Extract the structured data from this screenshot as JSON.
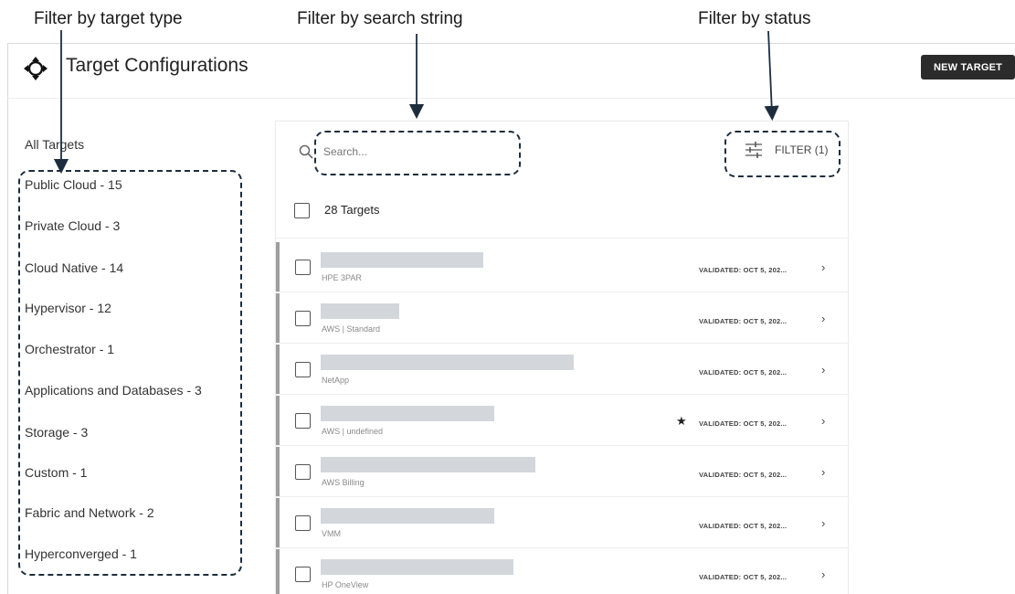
{
  "annotations": {
    "target_type": "Filter by target type",
    "search_string": "Filter by search string",
    "status": "Filter by status"
  },
  "header": {
    "title": "Target Configurations",
    "icon": "crosshair-move-icon",
    "new_target_label": "NEW TARGET"
  },
  "sidebar": {
    "all_targets": "All Targets",
    "categories": [
      {
        "label": "Public Cloud - 15"
      },
      {
        "label": "Private Cloud - 3"
      },
      {
        "label": "Cloud Native - 14"
      },
      {
        "label": "Hypervisor - 12"
      },
      {
        "label": "Orchestrator - 1"
      },
      {
        "label": "Applications and Databases - 3"
      },
      {
        "label": "Storage - 3"
      },
      {
        "label": "Custom - 1"
      },
      {
        "label": "Fabric and Network - 2"
      },
      {
        "label": "Hyperconverged - 1"
      }
    ]
  },
  "main": {
    "search_placeholder": "Search...",
    "filter_label": "FILTER (1)",
    "count_label": "28 Targets",
    "targets": [
      {
        "type": "HPE 3PAR",
        "status": "VALIDATED: OCT 5, 202...",
        "favorite": false
      },
      {
        "type": "AWS | Standard",
        "status": "VALIDATED: OCT 5, 202...",
        "favorite": false
      },
      {
        "type": "NetApp",
        "status": "VALIDATED: OCT 5, 202...",
        "favorite": false
      },
      {
        "type": "AWS | undefined",
        "status": "VALIDATED: OCT 5, 202...",
        "favorite": true
      },
      {
        "type": "AWS Billing",
        "status": "VALIDATED: OCT 5, 202...",
        "favorite": false
      },
      {
        "type": "VMM",
        "status": "VALIDATED: OCT 5, 202...",
        "favorite": false
      },
      {
        "type": "HP OneView",
        "status": "VALIDATED: OCT 5, 202...",
        "favorite": false
      }
    ]
  },
  "colors": {
    "primary_button": "#2b2b2b",
    "callout_border": "#1e2d3d",
    "row_indicator": "#9e9e9e",
    "placeholder_bar": "#d3d7db"
  }
}
